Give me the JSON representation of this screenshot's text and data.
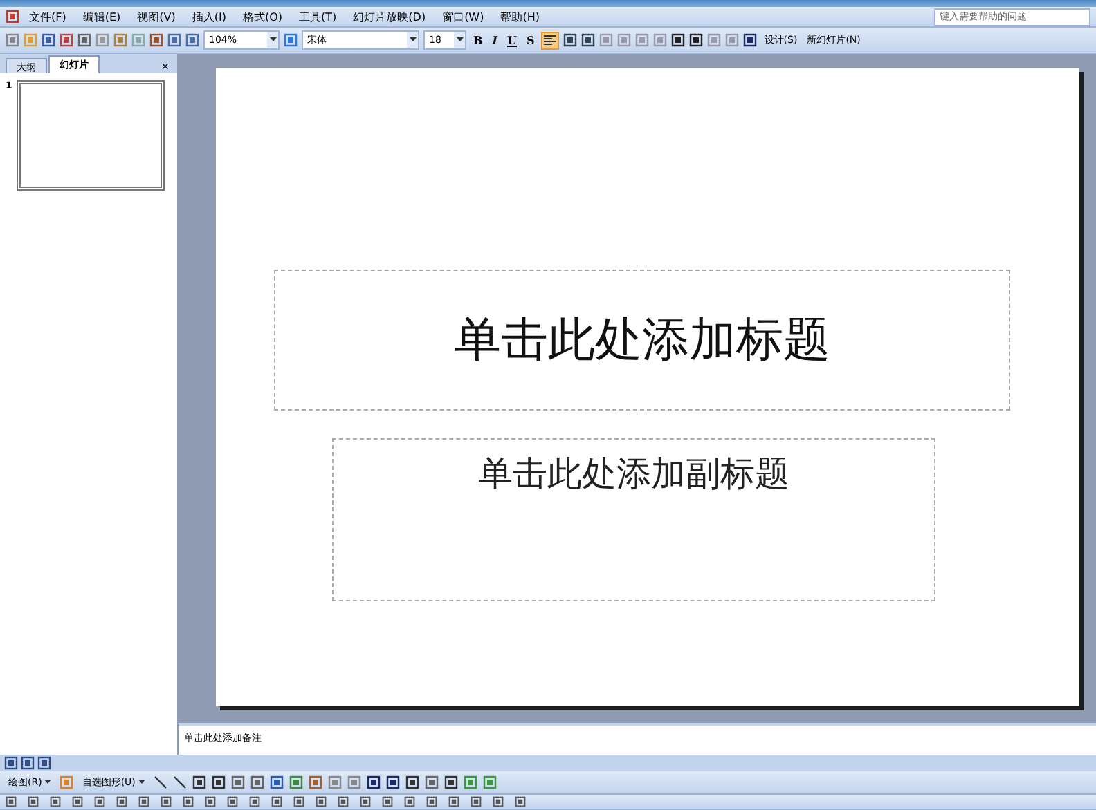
{
  "menu": [
    "文件(F)",
    "编辑(E)",
    "视图(V)",
    "插入(I)",
    "格式(O)",
    "工具(T)",
    "幻灯片放映(D)",
    "窗口(W)",
    "帮助(H)"
  ],
  "help_box": {
    "placeholder": "键入需要帮助的问题"
  },
  "toolbar": {
    "zoom": "104%",
    "font": "宋体",
    "font_size": "18",
    "bold": "B",
    "italic": "I",
    "underline": "U",
    "shadow": "S",
    "align_left_selected": true,
    "design": "设计(S)",
    "new_slide": "新幻灯片(N)"
  },
  "pane_tabs": [
    {
      "label": "大纲",
      "selected": false
    },
    {
      "label": "幻灯片",
      "selected": true
    }
  ],
  "pane_close": "×",
  "thumbnails": [
    {
      "number": "1",
      "selected": true
    }
  ],
  "slide": {
    "title": "单击此处添加标题",
    "subtitle": "单击此处添加副标题"
  },
  "notes": "单击此处添加备注",
  "drawing_toolbar": {
    "draw": "绘图(R)",
    "autoshapes": "自选图形(U)"
  }
}
